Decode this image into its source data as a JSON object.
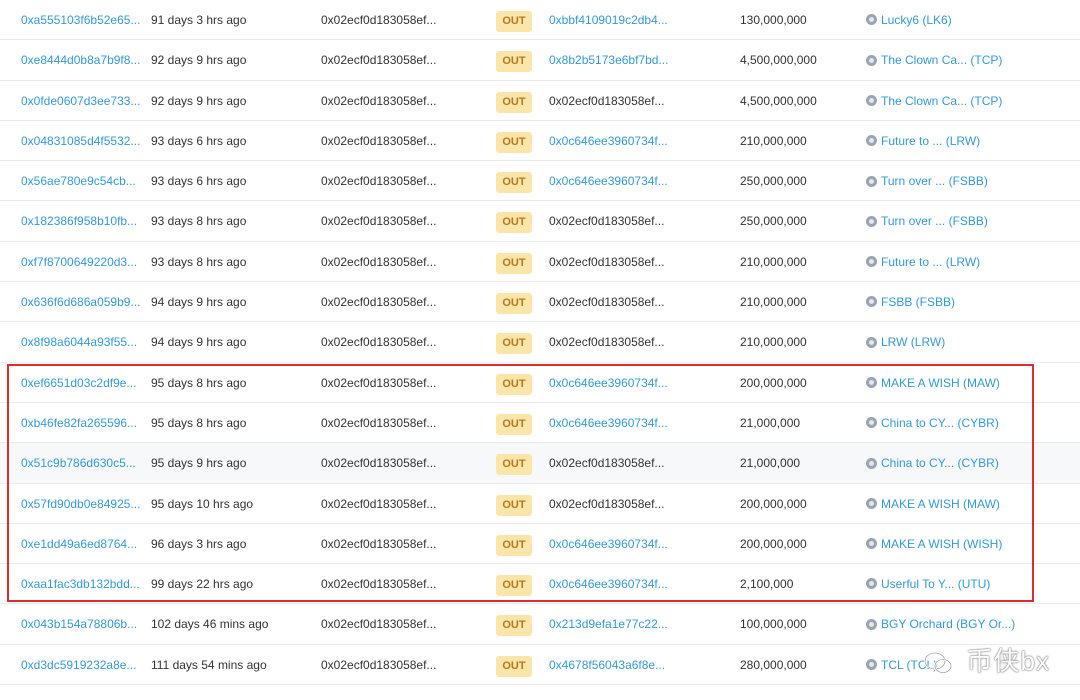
{
  "rows": [
    {
      "hash": "0xa555103f6b52e65...",
      "age": "91 days 3 hrs ago",
      "from": "0x02ecf0d183058ef...",
      "dir": "OUT",
      "to": "0xbbf4109019c2db4...",
      "to_link": true,
      "value": "130,000,000",
      "token": "Lucky6 (LK6)"
    },
    {
      "hash": "0xe8444d0b8a7b9f8...",
      "age": "92 days 9 hrs ago",
      "from": "0x02ecf0d183058ef...",
      "dir": "OUT",
      "to": "0x8b2b5173e6bf7bd...",
      "to_link": true,
      "value": "4,500,000,000",
      "token": "The Clown Ca... (TCP)"
    },
    {
      "hash": "0x0fde0607d3ee733...",
      "age": "92 days 9 hrs ago",
      "from": "0x02ecf0d183058ef...",
      "dir": "OUT",
      "to": "0x02ecf0d183058ef...",
      "to_link": false,
      "value": "4,500,000,000",
      "token": "The Clown Ca... (TCP)"
    },
    {
      "hash": "0x04831085d4f5532...",
      "age": "93 days 6 hrs ago",
      "from": "0x02ecf0d183058ef...",
      "dir": "OUT",
      "to": "0x0c646ee3960734f...",
      "to_link": true,
      "value": "210,000,000",
      "token": "Future to ... (LRW)"
    },
    {
      "hash": "0x56ae780e9c54cb...",
      "age": "93 days 6 hrs ago",
      "from": "0x02ecf0d183058ef...",
      "dir": "OUT",
      "to": "0x0c646ee3960734f...",
      "to_link": true,
      "value": "250,000,000",
      "token": "Turn over ... (FSBB)"
    },
    {
      "hash": "0x182386f958b10fb...",
      "age": "93 days 8 hrs ago",
      "from": "0x02ecf0d183058ef...",
      "dir": "OUT",
      "to": "0x02ecf0d183058ef...",
      "to_link": false,
      "value": "250,000,000",
      "token": "Turn over ... (FSBB)"
    },
    {
      "hash": "0xf7f8700649220d3...",
      "age": "93 days 8 hrs ago",
      "from": "0x02ecf0d183058ef...",
      "dir": "OUT",
      "to": "0x02ecf0d183058ef...",
      "to_link": false,
      "value": "210,000,000",
      "token": "Future to ... (LRW)"
    },
    {
      "hash": "0x636f6d686a059b9...",
      "age": "94 days 9 hrs ago",
      "from": "0x02ecf0d183058ef...",
      "dir": "OUT",
      "to": "0x02ecf0d183058ef...",
      "to_link": false,
      "value": "210,000,000",
      "token": "FSBB (FSBB)"
    },
    {
      "hash": "0x8f98a6044a93f55...",
      "age": "94 days 9 hrs ago",
      "from": "0x02ecf0d183058ef...",
      "dir": "OUT",
      "to": "0x02ecf0d183058ef...",
      "to_link": false,
      "value": "210,000,000",
      "token": "LRW (LRW)"
    },
    {
      "hash": "0xef6651d03c2df9e...",
      "age": "95 days 8 hrs ago",
      "from": "0x02ecf0d183058ef...",
      "dir": "OUT",
      "to": "0x0c646ee3960734f...",
      "to_link": true,
      "value": "200,000,000",
      "token": "MAKE A WISH (MAW)"
    },
    {
      "hash": "0xb46fe82fa265596...",
      "age": "95 days 8 hrs ago",
      "from": "0x02ecf0d183058ef...",
      "dir": "OUT",
      "to": "0x0c646ee3960734f...",
      "to_link": true,
      "value": "21,000,000",
      "token": "China to CY... (CYBR)"
    },
    {
      "hash": "0x51c9b786d630c5...",
      "age": "95 days 9 hrs ago",
      "from": "0x02ecf0d183058ef...",
      "dir": "OUT",
      "to": "0x02ecf0d183058ef...",
      "to_link": false,
      "value": "21,000,000",
      "token": "China to CY... (CYBR)"
    },
    {
      "hash": "0x57fd90db0e84925...",
      "age": "95 days 10 hrs ago",
      "from": "0x02ecf0d183058ef...",
      "dir": "OUT",
      "to": "0x02ecf0d183058ef...",
      "to_link": false,
      "value": "200,000,000",
      "token": "MAKE A WISH (MAW)"
    },
    {
      "hash": "0xe1dd49a6ed8764...",
      "age": "96 days 3 hrs ago",
      "from": "0x02ecf0d183058ef...",
      "dir": "OUT",
      "to": "0x0c646ee3960734f...",
      "to_link": true,
      "value": "200,000,000",
      "token": "MAKE A WISH (WISH)"
    },
    {
      "hash": "0xaa1fac3db132bdd...",
      "age": "99 days 22 hrs ago",
      "from": "0x02ecf0d183058ef...",
      "dir": "OUT",
      "to": "0x0c646ee3960734f...",
      "to_link": true,
      "value": "2,100,000",
      "token": "Userful To Y... (UTU)"
    },
    {
      "hash": "0x043b154a78806b...",
      "age": "102 days 46 mins ago",
      "from": "0x02ecf0d183058ef...",
      "dir": "OUT",
      "to": "0x213d9efa1e77c22...",
      "to_link": true,
      "value": "100,000,000",
      "token": "BGY Orchard (BGY Or...)"
    },
    {
      "hash": "0xd3dc5919232a8e...",
      "age": "111 days 54 mins ago",
      "from": "0x02ecf0d183058ef...",
      "dir": "OUT",
      "to": "0x4678f56043a6f8e...",
      "to_link": true,
      "value": "280,000,000",
      "token": "TCL (TCL)"
    }
  ],
  "watermark": {
    "text": "币侠bx"
  },
  "colors": {
    "link": "#3498db",
    "badge_bg": "#fbe5a9",
    "badge_text": "#b7791f",
    "highlight": "#e02b2b"
  }
}
